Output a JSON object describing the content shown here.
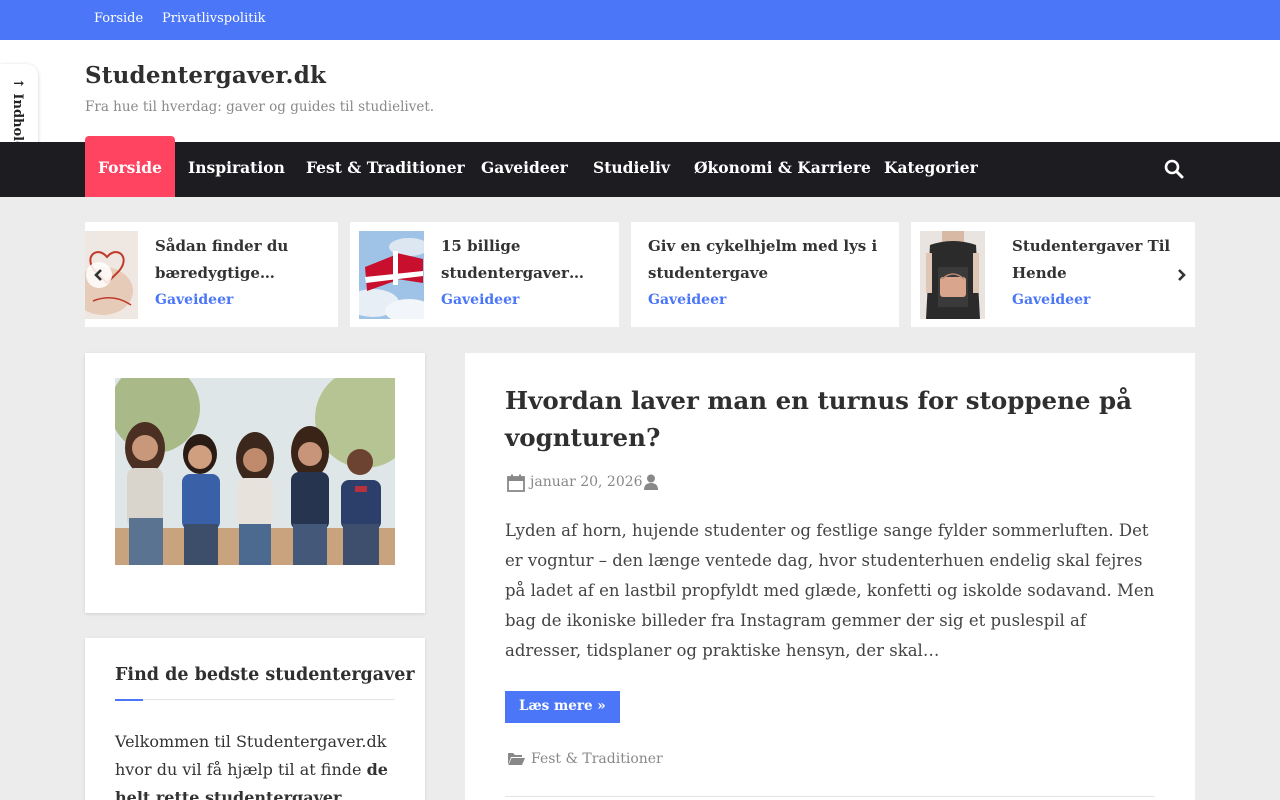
{
  "topbar": {
    "links": [
      "Forside",
      "Privatlivspolitik"
    ]
  },
  "skip_link": "↑ Indhold",
  "site": {
    "title": "Studentergaver.dk",
    "tagline": "Fra hue til hverdag: gaver og guides til studielivet."
  },
  "nav": {
    "items": [
      "Forside",
      "Inspiration",
      "Fest & Traditioner",
      "Gaveideer",
      "Studieliv",
      "Økonomi & Karriere",
      "Kategorier"
    ],
    "active_index": 0
  },
  "carousel": [
    {
      "title": "Sådan finder du bæredygtige…",
      "category": "Gaveideer",
      "image": "hand-heart"
    },
    {
      "title": "15 billige studentergaver…",
      "category": "Gaveideer",
      "image": "danish-flag-sky"
    },
    {
      "title": "Giv en cykelhjelm med lys i studentergave",
      "category": "Gaveideer",
      "image": "none"
    },
    {
      "title": "Studentergaver Til Hende",
      "category": "Gaveideer",
      "image": "woman-bag"
    }
  ],
  "sidebar": {
    "image": "group-of-students",
    "widget_title": "Find de bedste studentergaver",
    "widget_text_plain": "Velkommen til Studentergaver.dk hvor du vil få hjælp til at finde ",
    "widget_text_bold": "de helt rette studentergaver"
  },
  "post": {
    "title": "Hvordan laver man en turnus for stoppene på vognturen?",
    "date": "januar 20, 2026",
    "excerpt": "Lyden af horn, hujende studenter og festlige sange fylder sommerluften. Det er vogntur – den længe ventede dag, hvor studenterhuen endelig skal fejres på ladet af en lastbil propfyldt med glæde, konfetti og iskolde sodavand. Men bag de ikoniske billeder fra Instagram gemmer der sig et puslespil af adresser, tidsplaner og praktiske hensyn, der skal…",
    "read_more": "Læs mere »",
    "category": "Fest & Traditioner"
  },
  "colors": {
    "accent": "#4a76f7",
    "active_nav": "#ff4462",
    "nav_bg": "#1c1c21",
    "page_bg": "#ececec"
  }
}
